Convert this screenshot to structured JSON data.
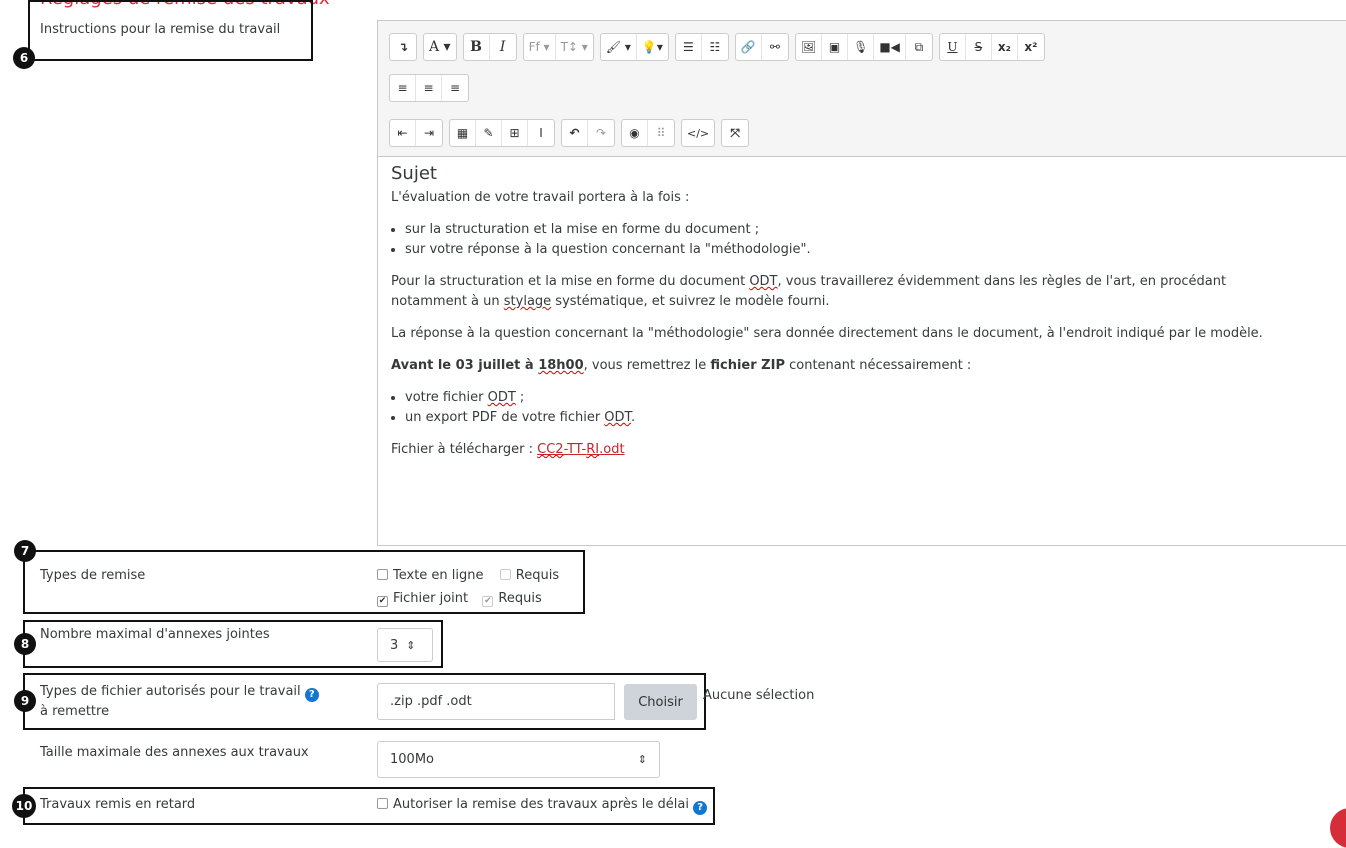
{
  "section_title": "Réglages de remise des travaux",
  "instructions": {
    "label": "Instructions pour la remise du travail",
    "badge": "6",
    "toolbar": {
      "row1": [
        [
          "insert-arrow-icon"
        ],
        [
          "font-color-icon"
        ],
        [
          "bold-icon",
          "italic-icon"
        ],
        [
          "font-family-icon",
          "font-size-icon"
        ],
        [
          "background-brush-icon",
          "highlight-icon"
        ],
        [
          "bullet-list-icon",
          "numbered-list-icon"
        ],
        [
          "link-icon",
          "unlink-icon"
        ],
        [
          "image-icon",
          "media-icon",
          "audio-record-icon",
          "video-record-icon",
          "manage-files-icon"
        ],
        [
          "underline-icon",
          "strikethrough-icon",
          "subscript-icon",
          "superscript-icon"
        ]
      ],
      "row2": [
        [
          "align-left-icon",
          "align-center-icon",
          "align-right-icon"
        ]
      ],
      "row3": [
        [
          "outdent-icon",
          "indent-icon"
        ],
        [
          "equation-icon",
          "edit-icon",
          "table-icon",
          "clear-formatting-icon"
        ],
        [
          "undo-icon",
          "redo-icon"
        ],
        [
          "accessibility-checker-icon",
          "screenreader-helper-icon"
        ],
        [
          "html-icon"
        ],
        [
          "fullscreen-icon"
        ]
      ]
    },
    "content": {
      "heading": "Sujet",
      "intro": "L'évaluation de votre travail portera à la fois :",
      "bullets1": [
        "sur la structuration et la mise en forme du document ;",
        "sur votre réponse à la question concernant la \"méthodologie\"."
      ],
      "p2_a": "Pour la structuration et la mise en forme du document ",
      "p2_odt": "ODT",
      "p2_b": ", vous travaillerez évidemment dans les règles de l'art, en procédant",
      "p2_c": "notamment à un ",
      "p2_stylage": "stylage",
      "p2_d": " systématique, et suivrez le modèle fourni.",
      "p3": "La réponse à la question concernant la \"méthodologie\" sera donnée directement dans le document, à l'endroit indiqué par le modèle.",
      "p4_bold1": "Avant le 03 juillet à ",
      "p4_bold_time": "18h00",
      "p4_mid": ", vous remettrez le ",
      "p4_bold2": "fichier ZIP",
      "p4_end": " contenant nécessairement :",
      "bullets2_a": "votre fichier ",
      "bullets2_odt": "ODT",
      "bullets2_a_end": " ;",
      "bullets2_b": "un export PDF de votre fichier ",
      "bullets2_b_odt": "ODT",
      "bullets2_b_end": ".",
      "download_label": "Fichier à télécharger : ",
      "download_link_1": "CC2",
      "download_link_2": "-TT-",
      "download_link_3": "RI",
      "download_link_4": ".odt"
    }
  },
  "submission_types": {
    "badge": "7",
    "label": "Types de remise",
    "online_text": "Texte en ligne",
    "online_required": "Requis",
    "file": "Fichier joint",
    "file_required": "Requis",
    "online_checked": false,
    "file_checked": true
  },
  "max_files": {
    "badge": "8",
    "label": "Nombre maximal d'annexes jointes",
    "value": "3",
    "arrow": "⇕"
  },
  "file_types": {
    "badge": "9",
    "label_line1": "Types de fichier autorisés pour le travail",
    "label_line2": "à remettre",
    "value": ".zip .pdf .odt",
    "button": "Choisir",
    "none_selected": "Aucune sélection"
  },
  "max_size": {
    "label": "Taille maximale des annexes aux travaux",
    "value": "100Mo",
    "arrow": "⇕"
  },
  "late": {
    "badge": "10",
    "label": "Travaux remis en retard",
    "checkbox_label": "Autoriser la remise des travaux après le délai",
    "checked": false
  },
  "colors": {
    "accent_red": "#d62d3a",
    "help_blue": "#1177d1"
  }
}
